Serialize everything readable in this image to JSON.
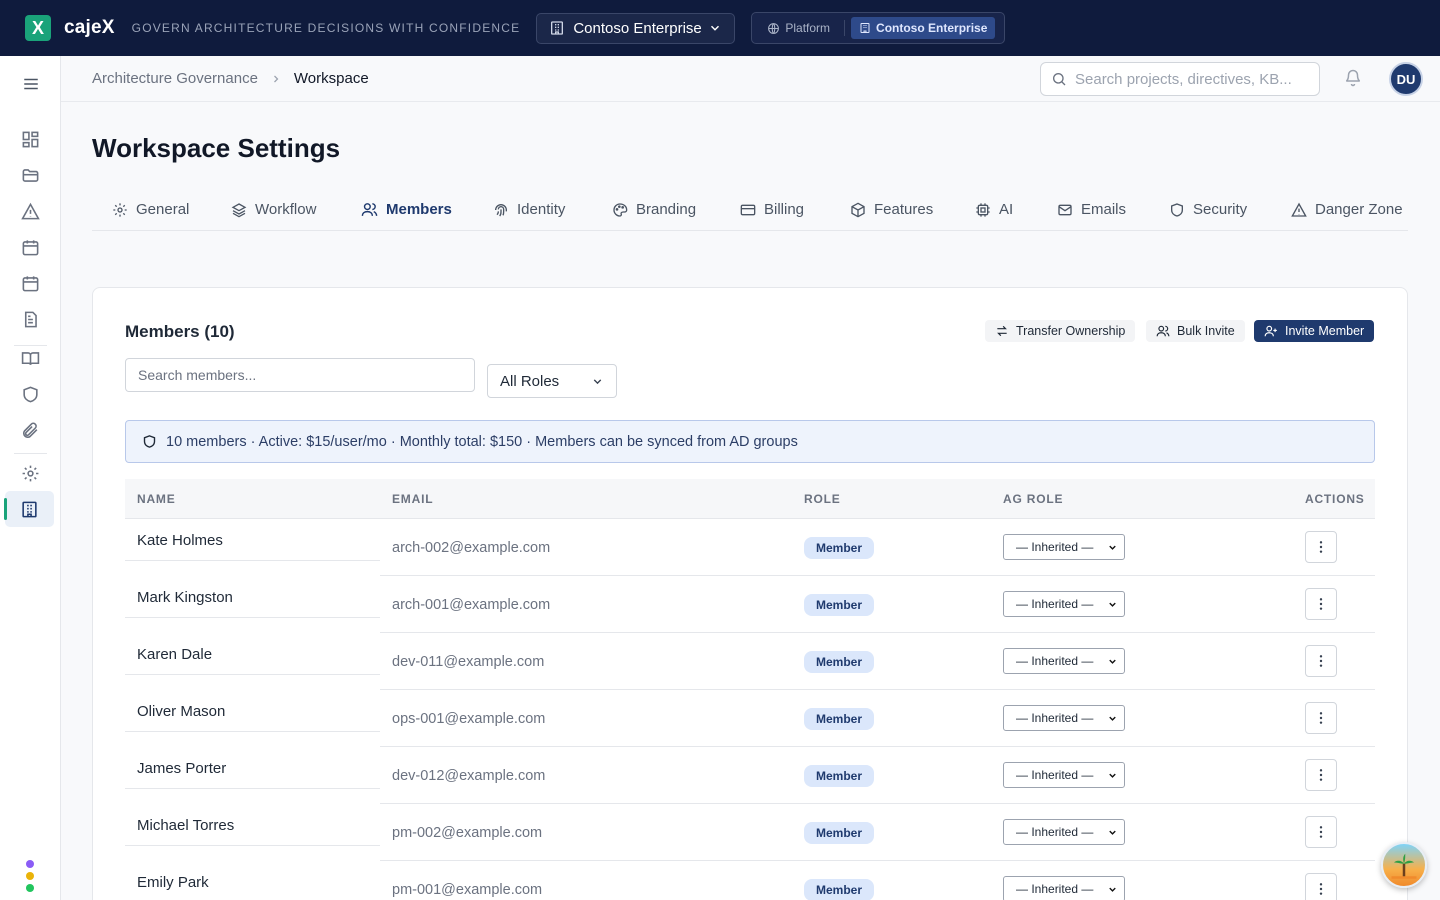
{
  "app": {
    "name": "cajeX",
    "logo_glyph": "X",
    "tagline": "GOVERN ARCHITECTURE DECISIONS WITH CONFIDENCE",
    "org_selector": "Contoso Enterprise",
    "context": {
      "platform": "Platform",
      "org": "Contoso Enterprise"
    }
  },
  "header": {
    "breadcrumb": [
      "Architecture Governance",
      "Workspace"
    ],
    "search_placeholder": "Search projects, directives, KB...",
    "avatar_initials": "DU"
  },
  "sidebar": {
    "items": [
      "menu-icon",
      "dashboard-icon",
      "folder-icon",
      "alert-triangle-icon",
      "calendar-icon",
      "calendar-grid-icon",
      "document-icon",
      "book-icon",
      "shield-icon",
      "paperclip-icon",
      "gear-icon",
      "building-icon"
    ],
    "active": "building-icon"
  },
  "page": {
    "title": "Workspace Settings"
  },
  "tabs": [
    {
      "label": "General",
      "icon": "gear-icon"
    },
    {
      "label": "Workflow",
      "icon": "layers-icon"
    },
    {
      "label": "Members",
      "icon": "users-icon",
      "active": true
    },
    {
      "label": "Identity",
      "icon": "fingerprint-icon"
    },
    {
      "label": "Branding",
      "icon": "palette-icon"
    },
    {
      "label": "Billing",
      "icon": "credit-card-icon"
    },
    {
      "label": "Features",
      "icon": "package-icon"
    },
    {
      "label": "AI",
      "icon": "chip-icon"
    },
    {
      "label": "Emails",
      "icon": "mail-icon"
    },
    {
      "label": "Security",
      "icon": "shield-icon"
    },
    {
      "label": "Danger Zone",
      "icon": "warning-icon"
    }
  ],
  "members": {
    "title": "Members (10)",
    "buttons": {
      "transfer": "Transfer Ownership",
      "bulk": "Bulk Invite",
      "invite": "Invite Member"
    },
    "search_placeholder": "Search members...",
    "role_filter": "All Roles",
    "info": "10 members · Active: $15/user/mo · Monthly total: $150 · Members can be synced from AD groups",
    "columns": {
      "name": "NAME",
      "email": "EMAIL",
      "role": "ROLE",
      "ag_role": "AG ROLE",
      "actions": "ACTIONS"
    },
    "rows": [
      {
        "name": "Kate Holmes",
        "email": "arch-002@example.com",
        "role": "Member",
        "ag_role": "— Inherited —"
      },
      {
        "name": "Mark Kingston",
        "email": "arch-001@example.com",
        "role": "Member",
        "ag_role": "— Inherited —"
      },
      {
        "name": "Karen Dale",
        "email": "dev-011@example.com",
        "role": "Member",
        "ag_role": "— Inherited —"
      },
      {
        "name": "Oliver Mason",
        "email": "ops-001@example.com",
        "role": "Member",
        "ag_role": "— Inherited —"
      },
      {
        "name": "James Porter",
        "email": "dev-012@example.com",
        "role": "Member",
        "ag_role": "— Inherited —"
      },
      {
        "name": "Michael Torres",
        "email": "pm-002@example.com",
        "role": "Member",
        "ag_role": "— Inherited —"
      },
      {
        "name": "Emily Park",
        "email": "pm-001@example.com",
        "role": "Member",
        "ag_role": "— Inherited —"
      }
    ]
  },
  "colors": {
    "navy": "#0f1b3d",
    "accent": "#1f3a6e",
    "green": "#1aa37a",
    "badge_bg": "#dbe7fb"
  }
}
